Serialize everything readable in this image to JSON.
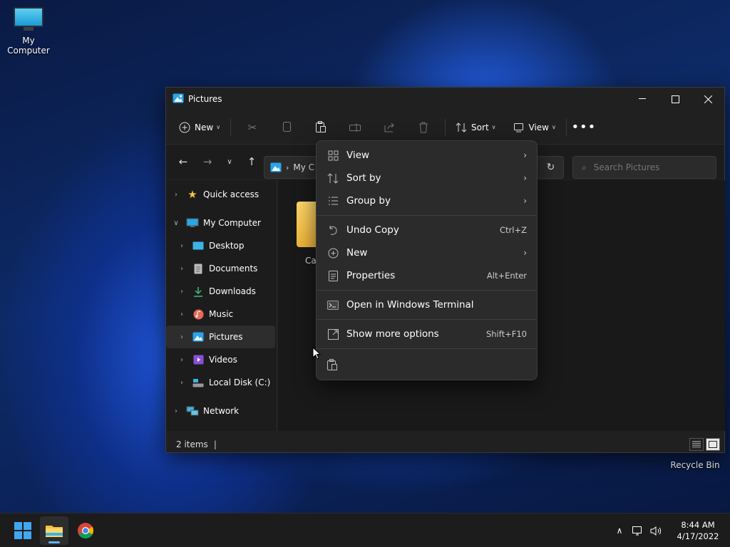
{
  "desktop": {
    "icons": [
      {
        "label": "My Computer",
        "icon": "computer-icon"
      },
      {
        "label": "Recycle Bin",
        "icon": "recycle-bin-icon"
      }
    ]
  },
  "window": {
    "title": "Pictures",
    "toolbar": {
      "new_label": "New",
      "sort_label": "Sort",
      "view_label": "View"
    },
    "address": {
      "path": "My C",
      "search_placeholder": "Search Pictures"
    },
    "nav": [
      {
        "label": "Quick access",
        "icon": "star-icon"
      },
      {
        "label": "My Computer",
        "icon": "computer-icon"
      },
      {
        "label": "Desktop",
        "icon": "desktop-icon"
      },
      {
        "label": "Documents",
        "icon": "documents-icon"
      },
      {
        "label": "Downloads",
        "icon": "downloads-icon"
      },
      {
        "label": "Music",
        "icon": "music-icon"
      },
      {
        "label": "Pictures",
        "icon": "pictures-icon"
      },
      {
        "label": "Videos",
        "icon": "videos-icon"
      },
      {
        "label": "Local Disk (C:)",
        "icon": "disk-icon"
      },
      {
        "label": "Network",
        "icon": "network-icon"
      }
    ],
    "content": {
      "folder_label": "Ca"
    },
    "status": {
      "items_text": "2 items",
      "cursor": "|"
    }
  },
  "context_menu": {
    "items": [
      {
        "label": "View",
        "icon": "grid-icon",
        "shortcut": "",
        "submenu": true
      },
      {
        "label": "Sort by",
        "icon": "sort-icon",
        "shortcut": "",
        "submenu": true
      },
      {
        "label": "Group by",
        "icon": "list-icon",
        "shortcut": "",
        "submenu": true
      },
      {
        "label": "Undo Copy",
        "icon": "undo-icon",
        "shortcut": "Ctrl+Z",
        "submenu": false
      },
      {
        "label": "New",
        "icon": "plus-circle-icon",
        "shortcut": "",
        "submenu": true
      },
      {
        "label": "Properties",
        "icon": "properties-icon",
        "shortcut": "Alt+Enter",
        "submenu": false
      },
      {
        "label": "Open in Windows Terminal",
        "icon": "terminal-icon",
        "shortcut": "",
        "submenu": false
      },
      {
        "label": "Show more options",
        "icon": "share-icon",
        "shortcut": "Shift+F10",
        "submenu": false
      }
    ]
  },
  "taskbar": {
    "time": "8:44 AM",
    "date": "4/17/2022"
  },
  "colors": {
    "accent": "#5fb2f2",
    "menu_bg": "#2b2b2b",
    "window_bg": "#202020"
  }
}
